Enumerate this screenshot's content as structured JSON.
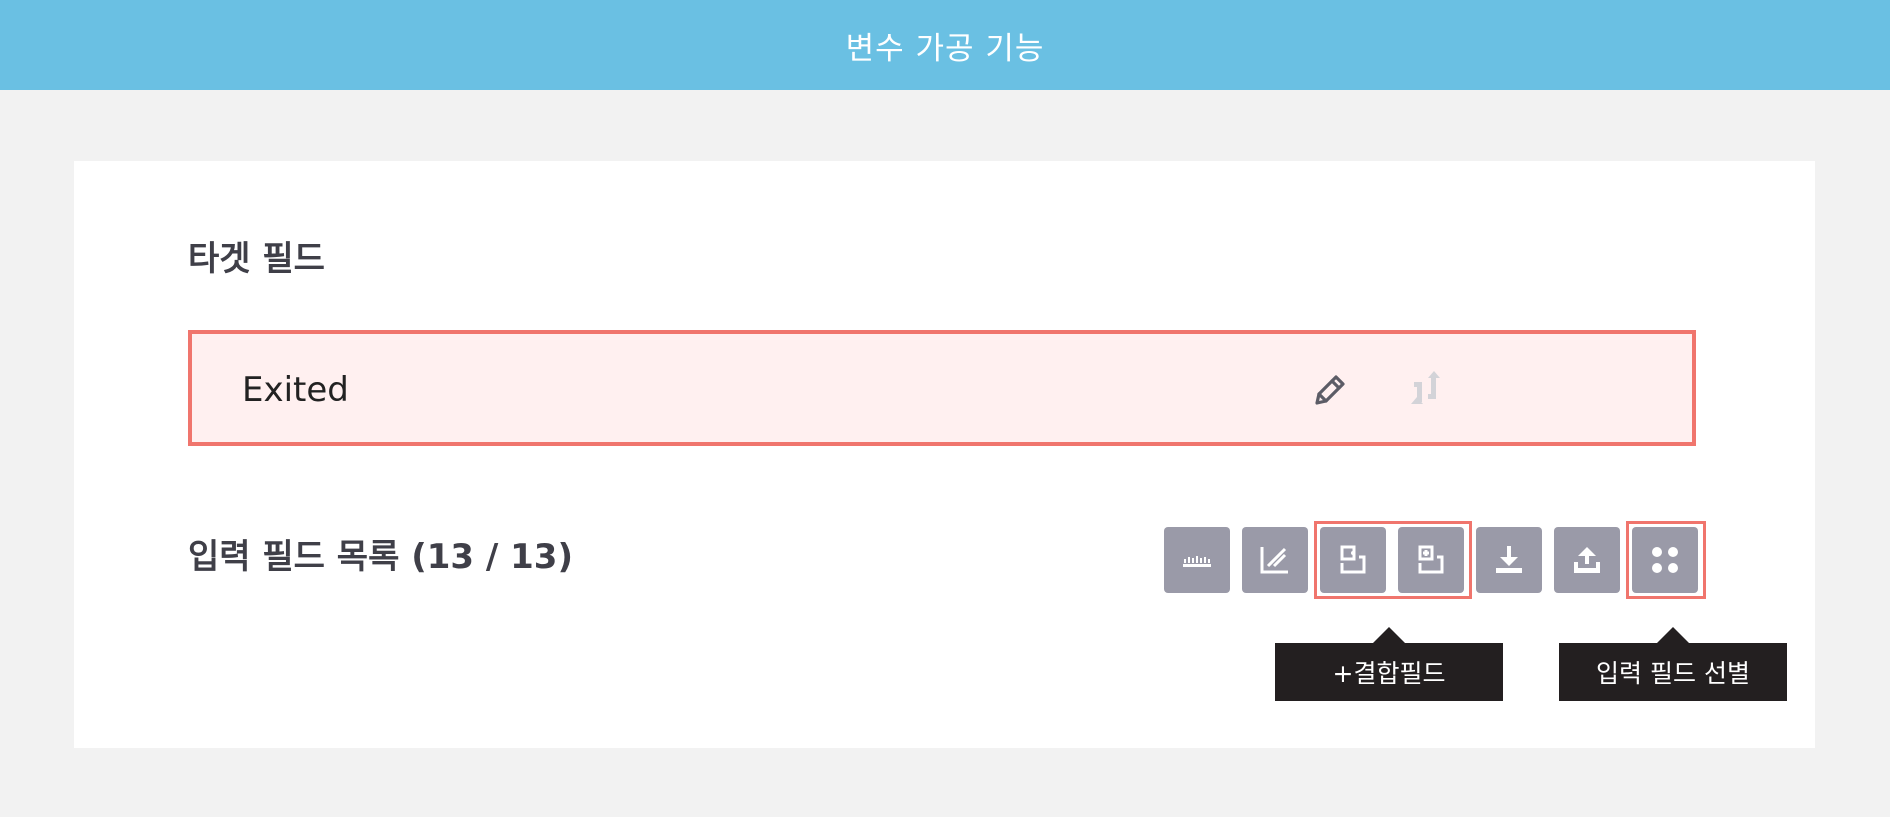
{
  "header": {
    "title": "변수 가공 기능"
  },
  "target_section": {
    "title": "타겟 필드",
    "field_value": "Exited",
    "edit_icon": "pencil-icon",
    "swap_icon": "swap-icon"
  },
  "input_section": {
    "title": "입력 필드 목록 (13 / 13)",
    "toolbar": [
      {
        "icon": "bin-icon"
      },
      {
        "icon": "transform-icon"
      },
      {
        "icon": "combine-field-icon"
      },
      {
        "icon": "combine-field-add-icon"
      },
      {
        "icon": "download-icon"
      },
      {
        "icon": "upload-icon"
      },
      {
        "icon": "select-fields-icon"
      }
    ]
  },
  "tooltips": {
    "combine": "+결합필드",
    "select": "입력 필드 선별"
  },
  "colors": {
    "header_bg": "#6ac0e3",
    "highlight": "#f0756d",
    "target_bg": "#fff0f0",
    "tool_bg": "#9a9aa8",
    "tooltip_bg": "#231f20"
  }
}
